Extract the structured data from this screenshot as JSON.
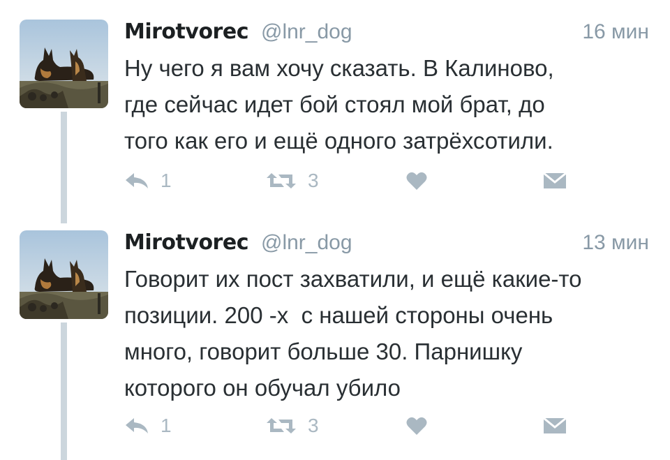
{
  "tweets": [
    {
      "name": "Mirotvorec",
      "handle": "@lnr_dog",
      "time": "16 мин",
      "text": "Ну чего я вам хочу сказать. В Калиново,\nгде сейчас идет бой стоял мой брат, до\nтого как его и ещё одного затрёхсотили.",
      "reply_count": "1",
      "retweet_count": "3"
    },
    {
      "name": "Mirotvorec",
      "handle": "@lnr_dog",
      "time": "13 мин",
      "text": "Говорит их пост захватили, и ещё какие-то\nпозиции. 200 -х  с нашей стороны очень\nмного, говорит больше 30. Парнишку\nкоторого он обучал убило",
      "reply_count": "1",
      "retweet_count": "3"
    }
  ],
  "icons": {
    "reply": "reply-icon",
    "retweet": "retweet-icon",
    "like": "heart-icon",
    "dm": "envelope-icon"
  },
  "colors": {
    "thread_line": "#ccd6dd",
    "icon": "#aab8c2",
    "secondary_text": "#8899a6",
    "primary_text": "#292f33"
  }
}
